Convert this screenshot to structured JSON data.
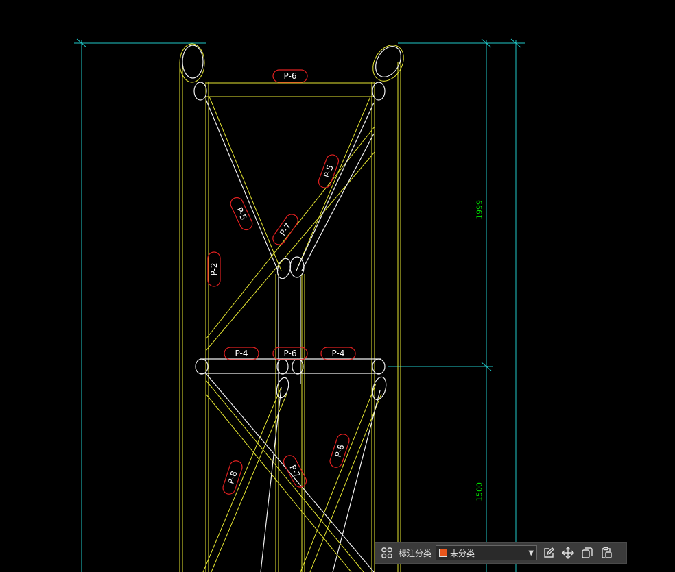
{
  "drawing": {
    "part_tags": [
      {
        "label": "P-6"
      },
      {
        "label": "P-5"
      },
      {
        "label": "P-5"
      },
      {
        "label": "P-7"
      },
      {
        "label": "P-2"
      },
      {
        "label": "P-4"
      },
      {
        "label": "P-6"
      },
      {
        "label": "P-4"
      },
      {
        "label": "P-8"
      },
      {
        "label": "P-7"
      },
      {
        "label": "P-8"
      }
    ],
    "dimensions": [
      {
        "value": "1999"
      },
      {
        "value": "1500"
      }
    ]
  },
  "toolbar": {
    "category_label": "标注分类",
    "category_value": "未分类",
    "category_color": "#e8561c",
    "icons": [
      "grid-icon",
      "edit-icon",
      "move-icon",
      "copy-icon",
      "paste-icon"
    ]
  }
}
